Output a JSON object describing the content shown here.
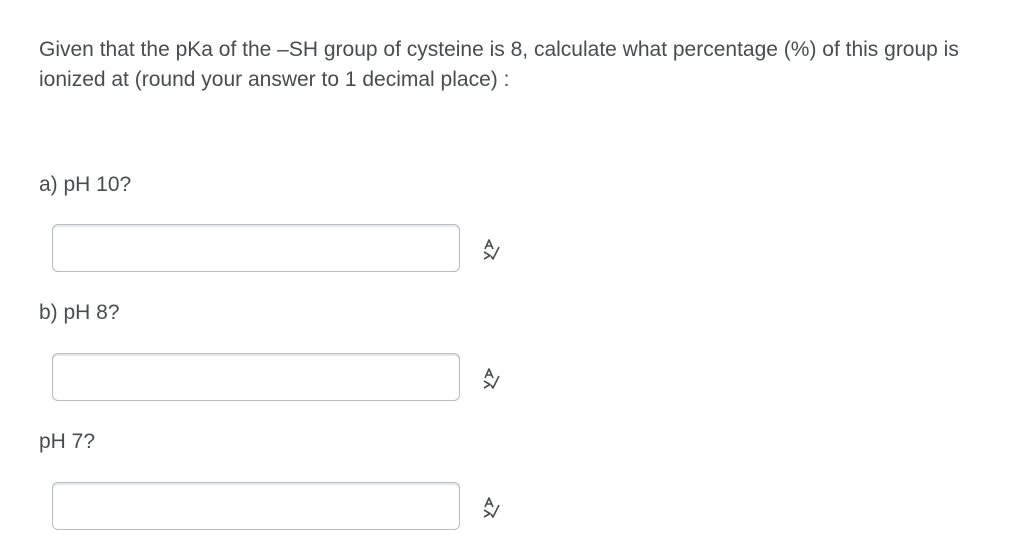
{
  "question": {
    "text": "Given that the pKa of the –SH group of cysteine is 8, calculate what percentage (%) of this group is ionized at (round your answer to 1 decimal place) :"
  },
  "parts": [
    {
      "label": "a) pH 10?",
      "value": "",
      "icon": "equation-editor-icon"
    },
    {
      "label": "b) pH 8?",
      "value": "",
      "icon": "equation-editor-icon"
    },
    {
      "label": "pH 7?",
      "value": "",
      "icon": "equation-editor-icon"
    }
  ]
}
